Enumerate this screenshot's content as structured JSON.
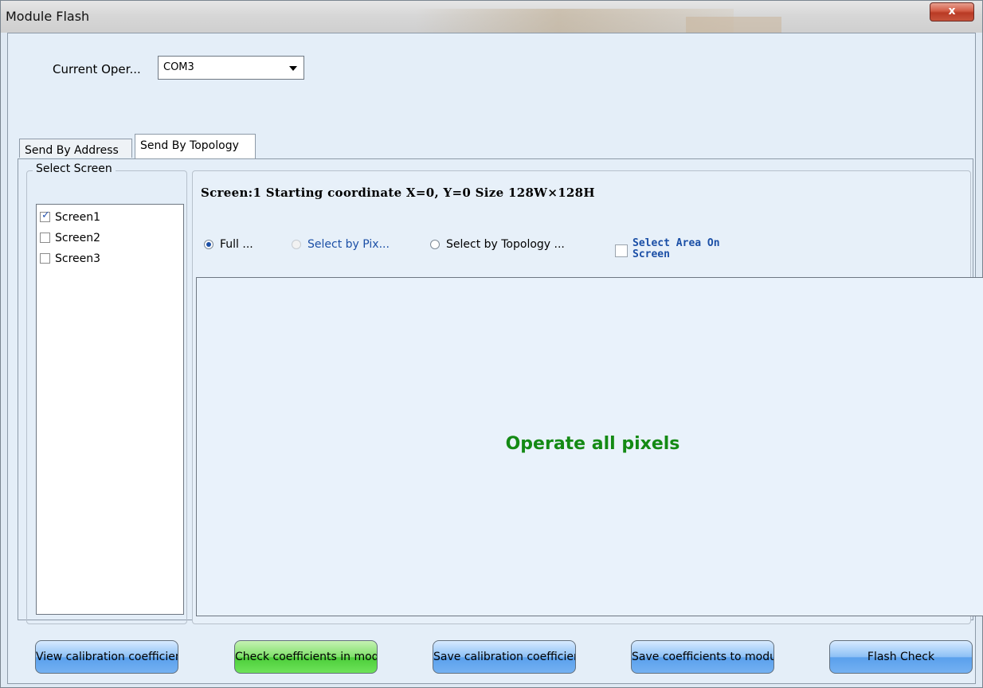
{
  "window": {
    "title": "Module Flash",
    "close_label": "x"
  },
  "operation": {
    "label": "Current Oper...",
    "port_value": "COM3"
  },
  "tabs": [
    {
      "label": "Send By Address",
      "active": false
    },
    {
      "label": "Send By Topology",
      "active": true
    }
  ],
  "select_screen": {
    "title": "Select Screen",
    "items": [
      {
        "label": "Screen1",
        "checked": true
      },
      {
        "label": "Screen2",
        "checked": false
      },
      {
        "label": "Screen3",
        "checked": false
      }
    ]
  },
  "screen_info": "Screen:1  Starting coordinate X=0, Y=0   Size 128W×128H",
  "modes": [
    {
      "label": "Full ...",
      "selected": true,
      "enabled": true
    },
    {
      "label": "Select by Pix...",
      "selected": false,
      "enabled": false
    },
    {
      "label": "Select by Topology ...",
      "selected": false,
      "enabled": true
    }
  ],
  "select_area": {
    "line1": "Select Area On",
    "line2": "Screen",
    "checked": false
  },
  "pixel_area": {
    "message": "Operate all pixels"
  },
  "buttons": [
    {
      "label": "View calibration coefficient...",
      "style": "blue"
    },
    {
      "label": "Check coefficients in modu...",
      "style": "green"
    },
    {
      "label": "Save calibration coefficient...",
      "style": "blue"
    },
    {
      "label": "Save coefficients to modules",
      "style": "blue"
    },
    {
      "label": "Flash Check",
      "style": "blue"
    }
  ],
  "colors": {
    "accent_blue": "#1b4fa6",
    "success_green": "#148a14"
  }
}
